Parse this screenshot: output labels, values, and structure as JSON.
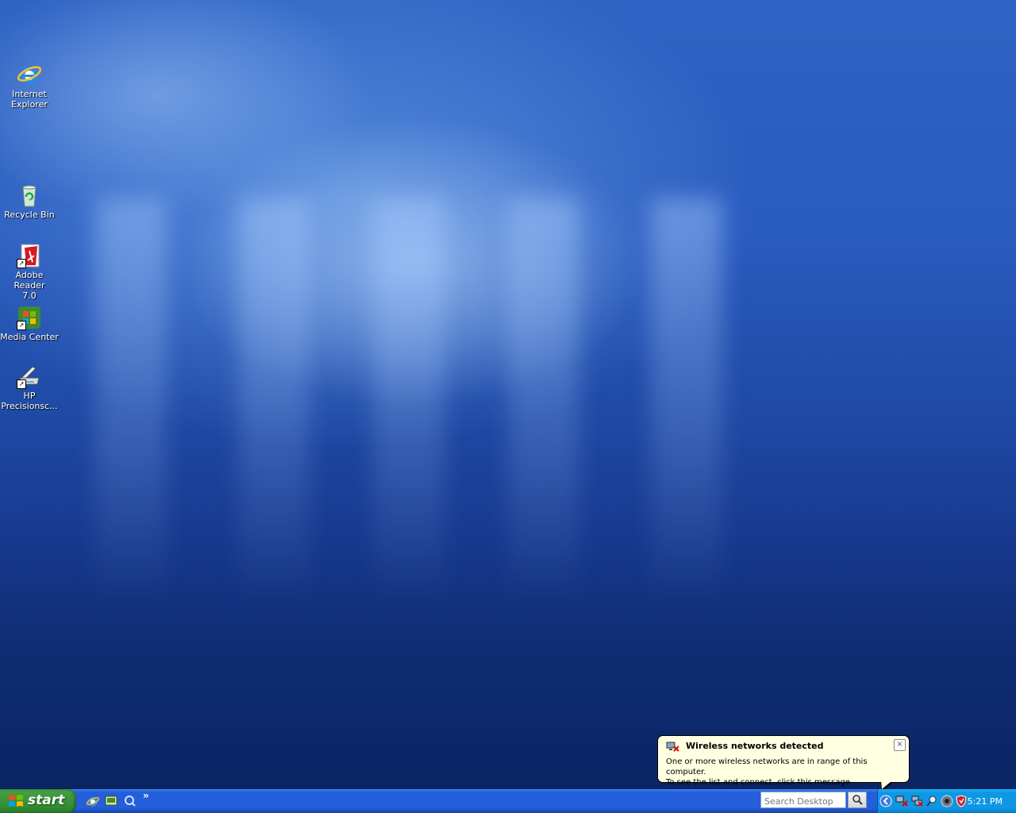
{
  "desktop": {
    "icons": [
      {
        "label": "Internet\nExplorer",
        "icon": "internet-explorer-icon"
      },
      {
        "label": "Recycle Bin",
        "icon": "recycle-bin-icon"
      },
      {
        "label": "Adobe Reader\n7.0",
        "icon": "adobe-reader-icon"
      },
      {
        "label": "Media Center",
        "icon": "media-center-icon"
      },
      {
        "label": "HP\nPrecisionsc...",
        "icon": "hp-scanner-icon"
      }
    ]
  },
  "balloon": {
    "title": "Wireless networks detected",
    "line1": "One or more wireless networks are in range of this computer.",
    "line2": "To see the list and connect, click this message",
    "close_glyph": "×"
  },
  "taskbar": {
    "start_label": "start",
    "quick_launch_more": "»",
    "search_placeholder": "Search Desktop",
    "clock": "5:21 PM"
  },
  "colors": {
    "taskbar": "#245edb",
    "start_button": "#3c973c",
    "tray": "#0f97e3",
    "balloon": "#ffffe1"
  }
}
